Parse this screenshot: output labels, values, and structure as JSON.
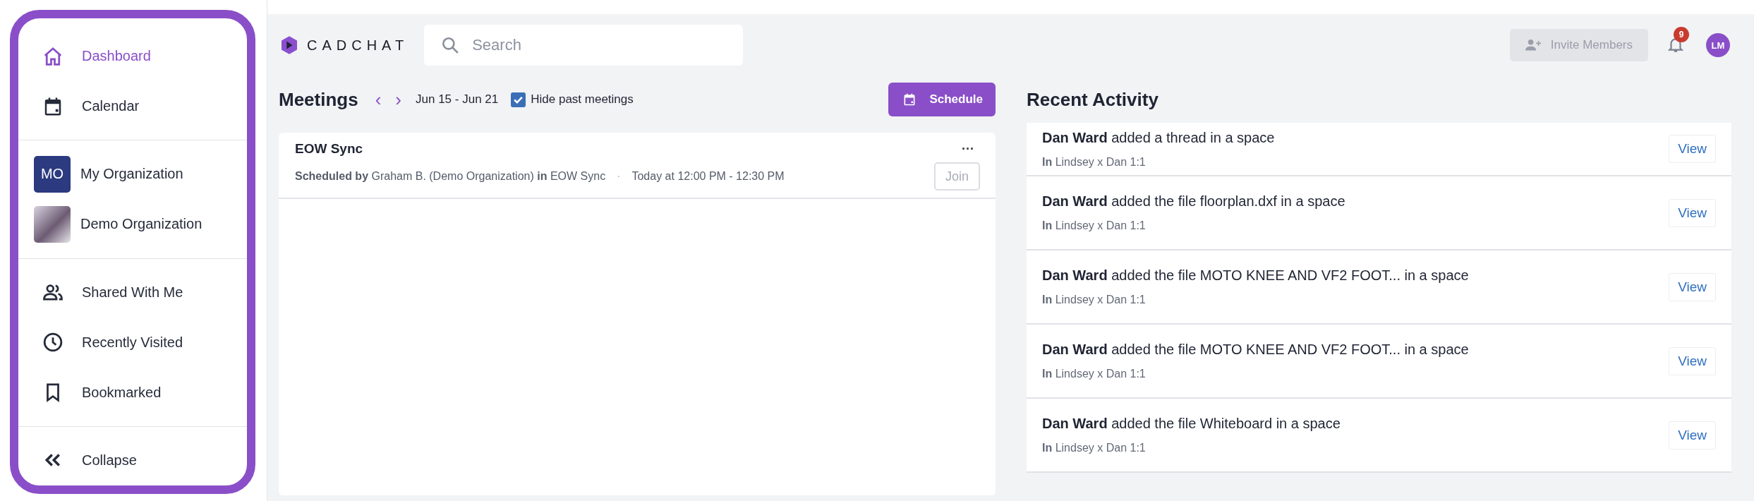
{
  "sidebar": {
    "items": [
      {
        "kind": "nav",
        "label": "Dashboard",
        "selected": true
      },
      {
        "kind": "nav",
        "label": "Calendar",
        "selected": false
      },
      {
        "kind": "divider"
      },
      {
        "kind": "org",
        "initials": "MO",
        "label": "My Organization",
        "selected": false
      },
      {
        "kind": "org",
        "label": "Demo Organization",
        "selected": false
      },
      {
        "kind": "divider"
      },
      {
        "kind": "nav",
        "label": "Shared With Me",
        "selected": false
      },
      {
        "kind": "nav",
        "label": "Recently Visited",
        "selected": false
      },
      {
        "kind": "nav",
        "label": "Bookmarked",
        "selected": false
      },
      {
        "kind": "divider"
      },
      {
        "kind": "nav",
        "label": "Collapse",
        "selected": false
      }
    ]
  },
  "header": {
    "logo": "CADCHAT",
    "search": {
      "placeholder": "Search"
    },
    "invite_button": {
      "label": "Invite Members",
      "disabled": true
    },
    "notifications": {
      "count": "9"
    },
    "avatar": "LM"
  },
  "meetings": {
    "title": "Meetings",
    "prev": "‹",
    "next": "›",
    "range": "Jun 15 - Jun 21",
    "hide_past": {
      "label": "Hide past meetings",
      "checked": true
    },
    "schedule_button": "Schedule",
    "items": [
      {
        "title": "EOW Sync",
        "menu": "···",
        "detail": "**Scheduled by** Graham B. (Demo Organization) **in** EOW Sync",
        "separator": "·",
        "time": "Today at 12:00 PM - 12:30 PM",
        "join": {
          "label": "Join",
          "disabled": true
        }
      }
    ]
  },
  "recent_activity": {
    "title": "Recent Activity",
    "items": [
      {
        "text": "**Dan Ward** added a thread in a space",
        "location": "**In** Lindsey x Dan 1:1",
        "action": "View"
      },
      {
        "text": "**Dan Ward** added the file floorplan.dxf in a space",
        "location": "**In** Lindsey x Dan 1:1",
        "action": "View"
      },
      {
        "text": "**Dan Ward** added the file MOTO KNEE AND VF2 FOOT... in a space",
        "location": "**In** Lindsey x Dan 1:1",
        "action": "View"
      },
      {
        "text": "**Dan Ward** added the file MOTO KNEE AND VF2 FOOT... in a space",
        "location": "**In** Lindsey x Dan 1:1",
        "action": "View"
      },
      {
        "text": "**Dan Ward** added the file Whiteboard in a space",
        "location": "**In** Lindsey x Dan 1:1",
        "action": "View"
      }
    ]
  }
}
